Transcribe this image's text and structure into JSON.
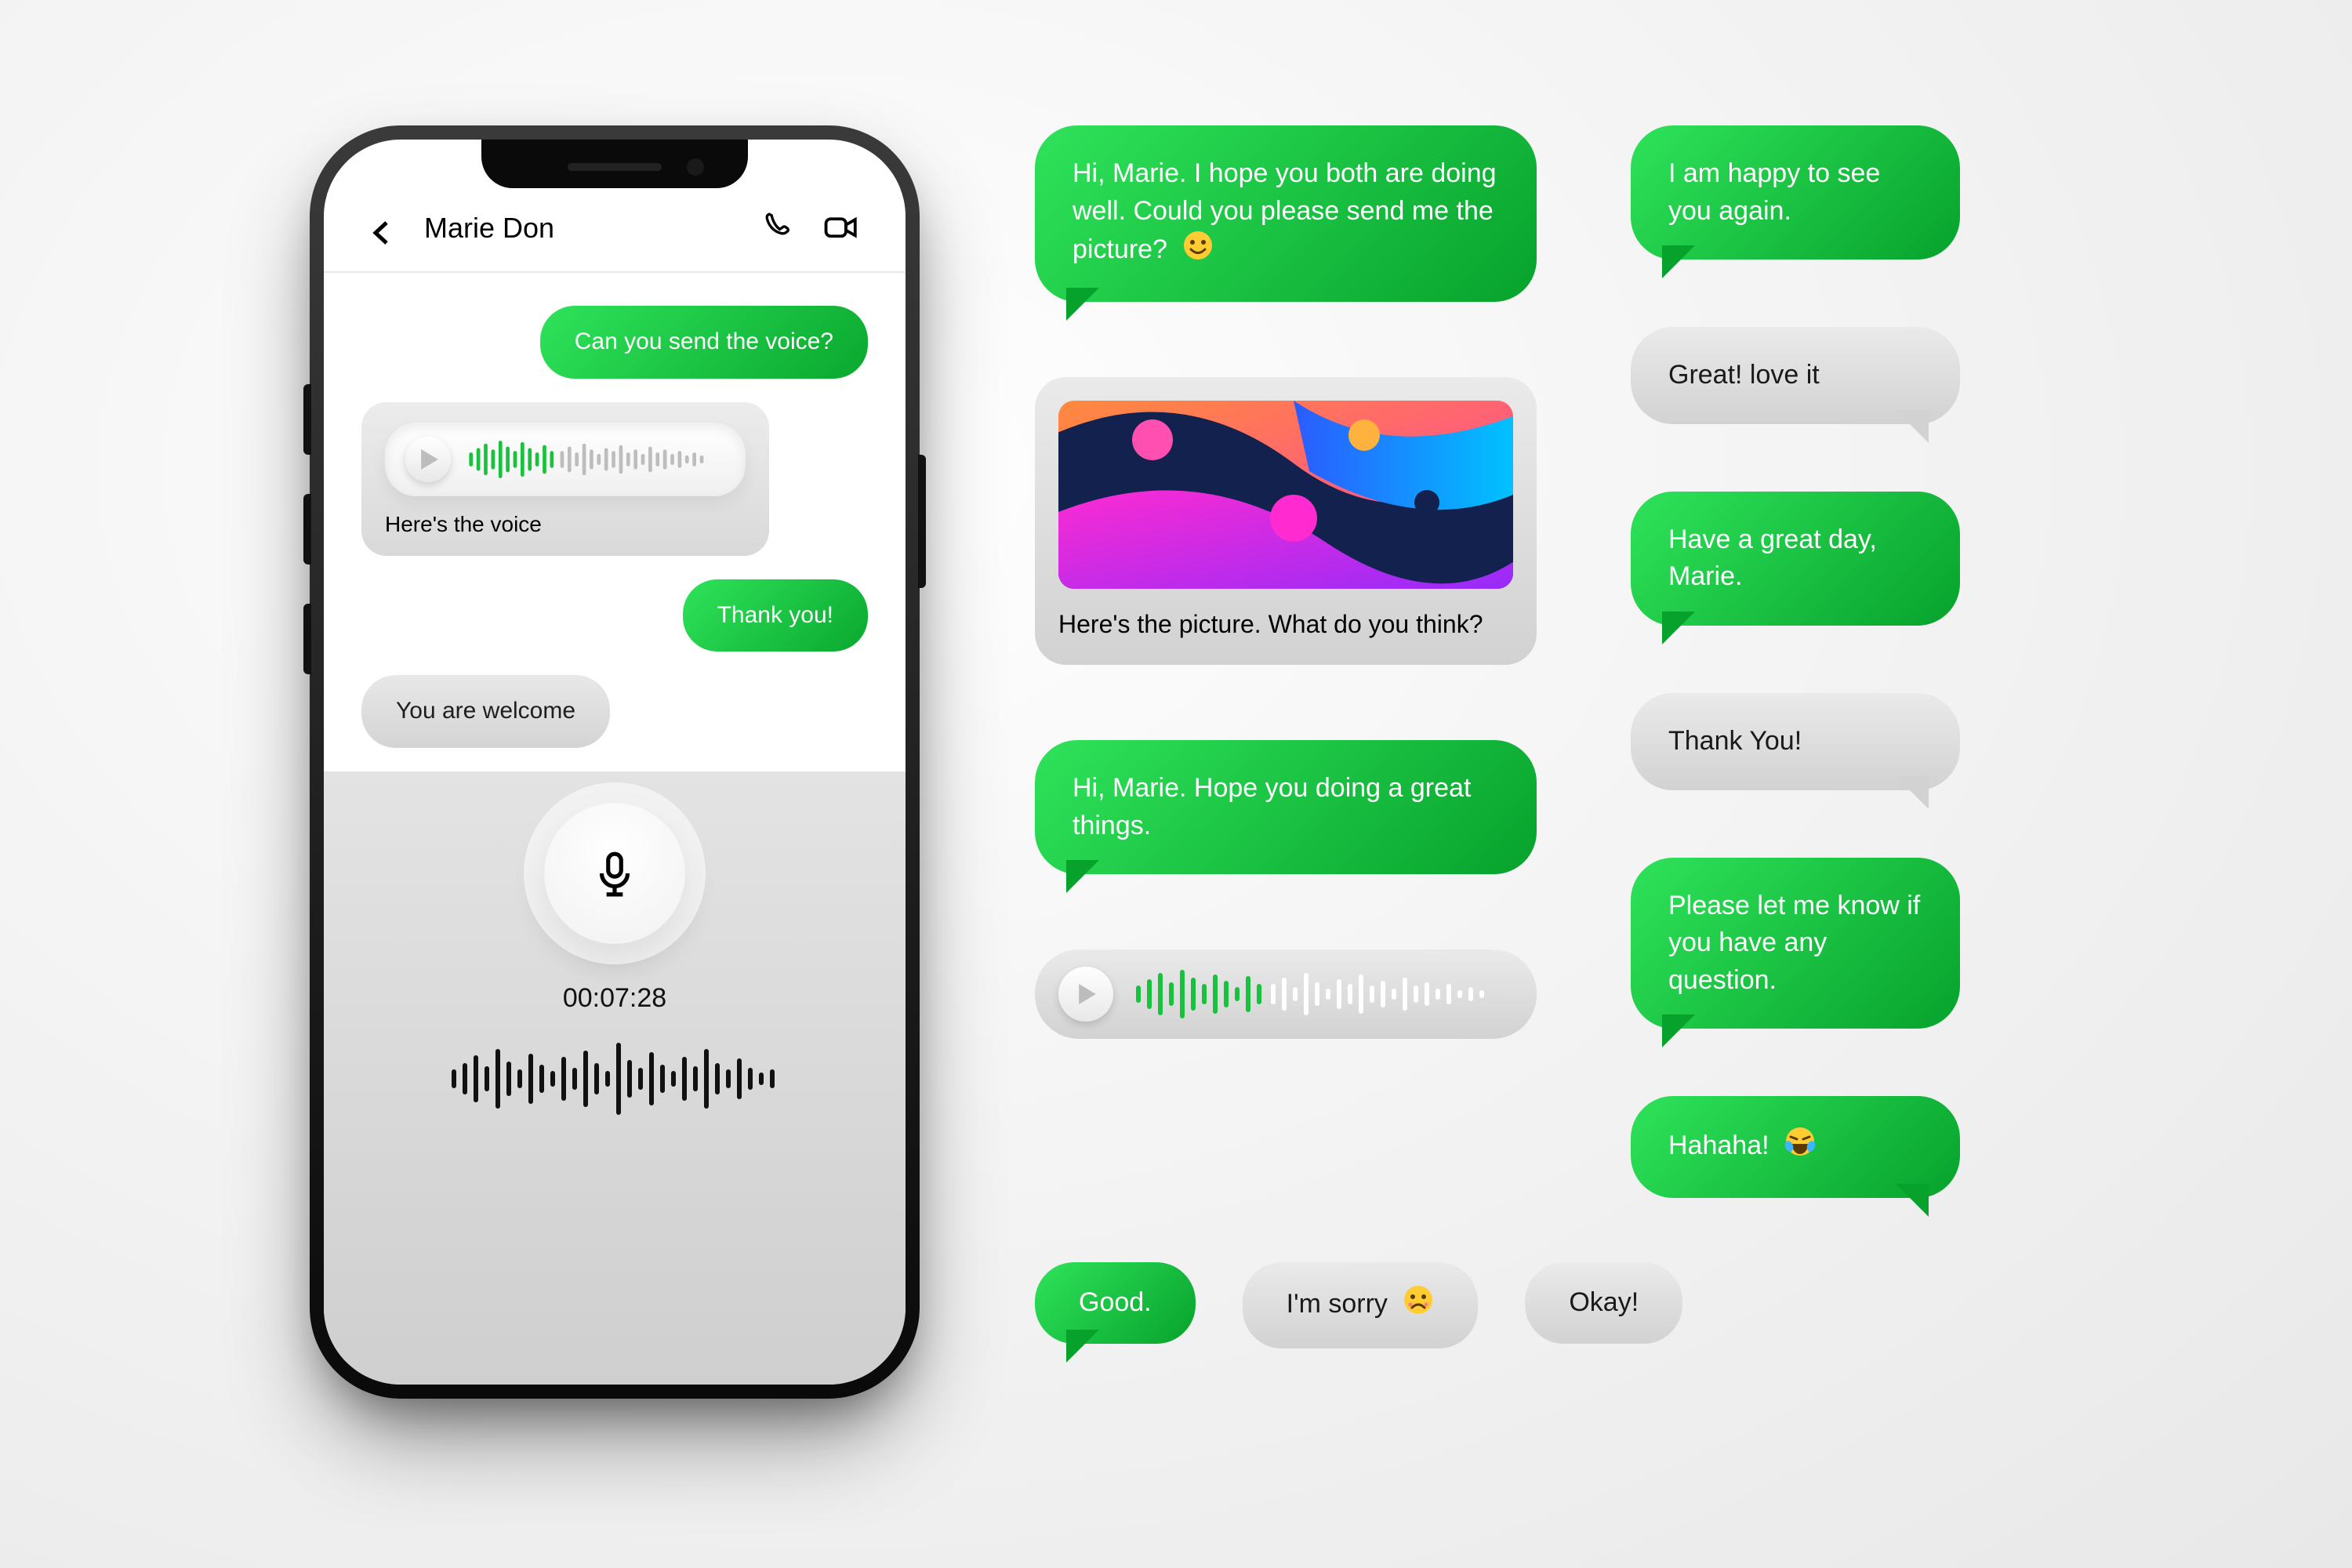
{
  "phone": {
    "contact_name": "Marie Don",
    "messages": {
      "m1": "Can you send the voice?",
      "m2_caption": "Here's the voice",
      "m3": "Thank you!",
      "m4": "You are welcome"
    },
    "timer": "00:07:28"
  },
  "gallery": {
    "a1": "Hi, Marie. I hope you both are doing well. Could you please send me the picture?",
    "a2_caption": "Here's the picture. What do you think?",
    "a3": "Hi, Marie. Hope you doing a great things.",
    "b1": "I am happy to see you again.",
    "b2": "Great! love it",
    "b3": "Have a great day, Marie.",
    "b4": "Thank You!",
    "b5": "Please let me know if you have any question.",
    "b6": "Hahaha!",
    "r1": "Good.",
    "r2": "I'm sorry",
    "r3": "Okay!"
  }
}
